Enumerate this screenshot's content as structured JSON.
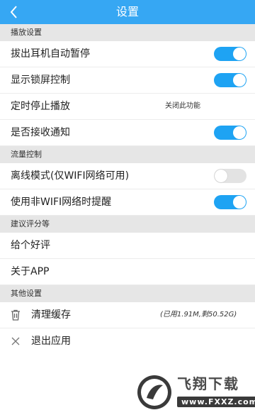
{
  "header": {
    "title": "设置",
    "back_icon": "chevron-left-icon"
  },
  "sections": {
    "playback": {
      "title": "播放设置",
      "items": [
        {
          "label": "拔出耳机自动暂停",
          "toggle": true
        },
        {
          "label": "显示锁屏控制",
          "toggle": true
        },
        {
          "label": "定时停止播放",
          "value": "关闭此功能"
        },
        {
          "label": "是否接收通知",
          "toggle": true
        }
      ]
    },
    "traffic": {
      "title": "流量控制",
      "items": [
        {
          "label": "离线模式(仅WIFI网络可用)",
          "toggle": false
        },
        {
          "label": "使用非WIFI网络时提醒",
          "toggle": true
        }
      ]
    },
    "feedback": {
      "title": "建议评分等",
      "items": [
        {
          "label": "给个好评"
        },
        {
          "label": "关于APP"
        }
      ]
    },
    "other": {
      "title": "其他设置",
      "items": [
        {
          "label": "清理缓存",
          "value": "(已用1.91M,剩50.52G)",
          "icon": "trash-icon"
        },
        {
          "label": "退出应用",
          "icon": "close-icon"
        }
      ]
    }
  },
  "watermark": {
    "name": "飞翔下载",
    "url": "www.FXXZ.com"
  },
  "colors": {
    "accent": "#36a7f3",
    "toggle_on": "#1ea3f3",
    "section_bg": "#e6e6e6"
  }
}
